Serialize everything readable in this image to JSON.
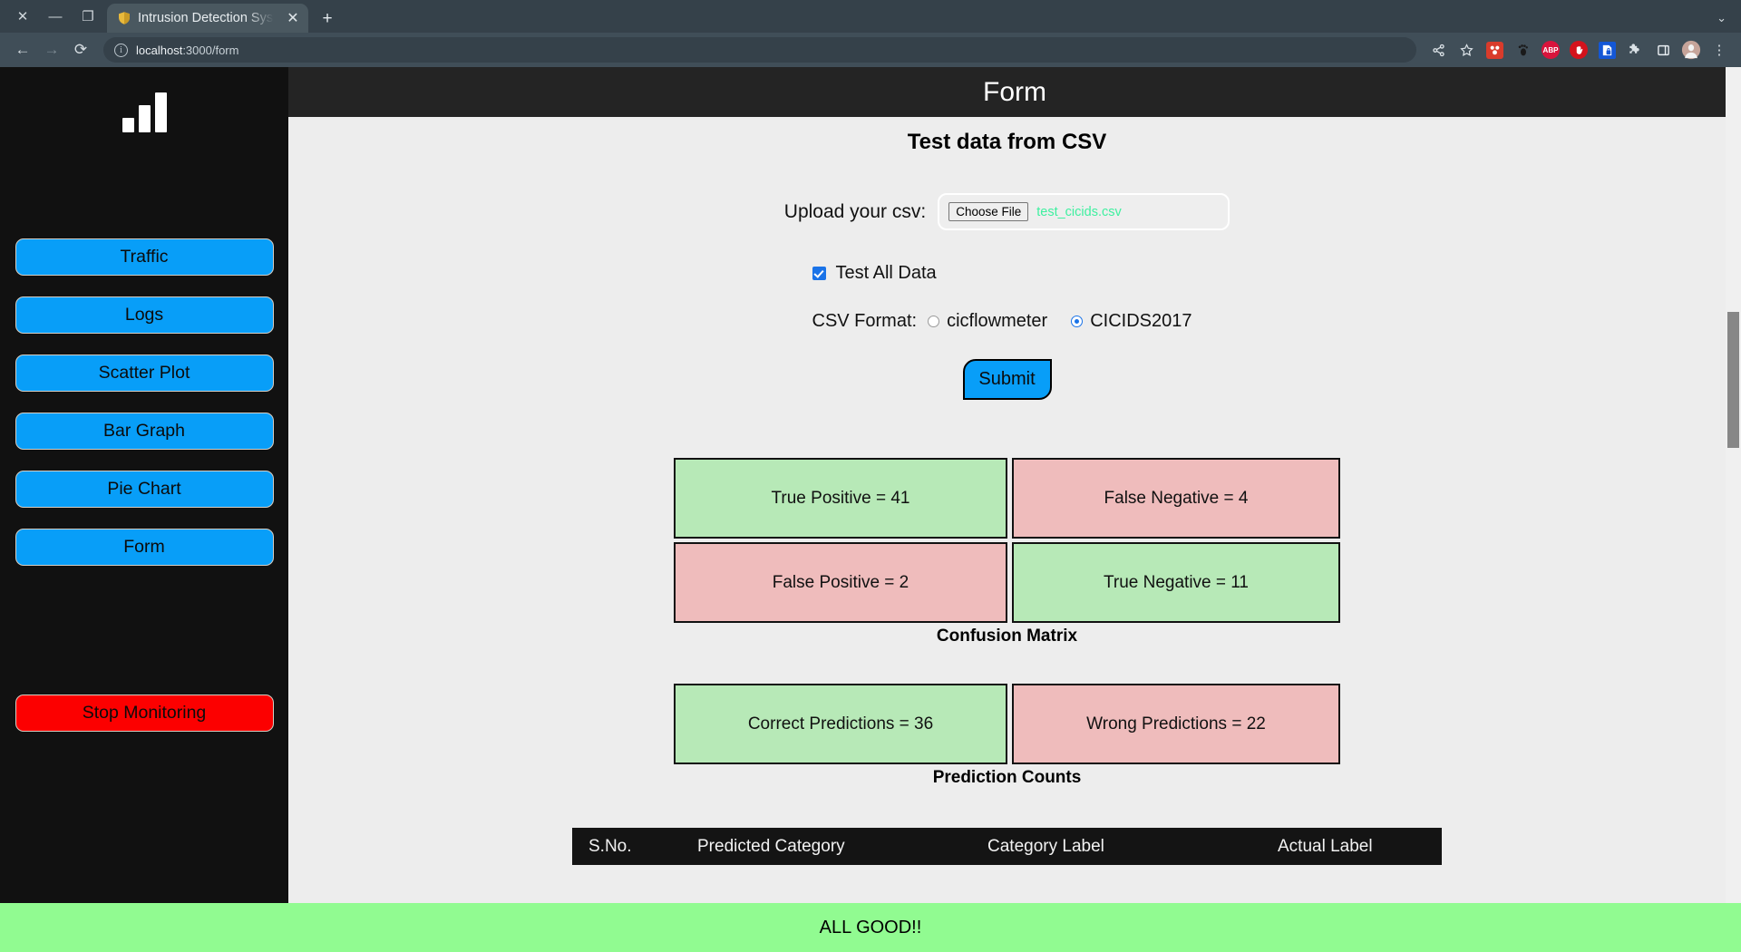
{
  "browser": {
    "window_controls": [
      {
        "name": "close-window-button",
        "glyph": "✕"
      },
      {
        "name": "minimize-window-button",
        "glyph": "—"
      },
      {
        "name": "restore-window-button",
        "glyph": "❐"
      }
    ],
    "tab": {
      "title": "Intrusion Detection Syst",
      "favicon": "shield-icon",
      "close_glyph": "✕"
    },
    "new_tab_glyph": "+",
    "collapse_glyph": "⌄",
    "nav": {
      "back_glyph": "←",
      "forward_glyph": "→",
      "reload_glyph": "⟳"
    },
    "omnibox": {
      "info_glyph": "i",
      "host": "localhost",
      "path": ":3000/form"
    },
    "toolbar_icons": [
      {
        "name": "share-icon",
        "glyph": "≪"
      },
      {
        "name": "bookmark-star-icon",
        "glyph": "☆"
      },
      {
        "name": "extension-red-icon",
        "label": "",
        "color": "#d93b2b"
      },
      {
        "name": "extension-footprint-icon",
        "label": "",
        "color": "#404e58"
      },
      {
        "name": "extension-abp-icon",
        "label": "ABP",
        "color": "#d9143c"
      },
      {
        "name": "extension-stop-hand-icon",
        "label": "",
        "color": "#d4121c"
      },
      {
        "name": "extension-lock-blue-icon",
        "label": "",
        "color": "#1457d6"
      },
      {
        "name": "extensions-puzzle-icon",
        "glyph": "✦"
      },
      {
        "name": "sidepanel-icon",
        "glyph": "▣"
      },
      {
        "name": "profile-avatar-icon",
        "glyph": ""
      },
      {
        "name": "chrome-menu-icon",
        "glyph": "⋮"
      }
    ]
  },
  "sidebar": {
    "logo": {
      "name": "bar-chart-logo",
      "bars": [
        16,
        30,
        44
      ]
    },
    "items": [
      {
        "label": "Traffic"
      },
      {
        "label": "Logs"
      },
      {
        "label": "Scatter Plot"
      },
      {
        "label": "Bar Graph"
      },
      {
        "label": "Pie Chart"
      },
      {
        "label": "Form"
      }
    ],
    "stop_button": {
      "label": "Stop Monitoring"
    }
  },
  "header": {
    "title": "Form"
  },
  "main": {
    "section_title": "Test data from CSV",
    "upload": {
      "label": "Upload your csv:",
      "choose_file_label": "Choose File",
      "file_name": "test_cicids.csv"
    },
    "test_all_data": {
      "label": "Test All Data",
      "checked": true
    },
    "csv_format": {
      "label": "CSV Format:",
      "options": [
        {
          "label": "cicflowmeter",
          "selected": false
        },
        {
          "label": "CICIDS2017",
          "selected": true
        }
      ]
    },
    "submit_label": "Submit",
    "confusion_matrix": {
      "caption": "Confusion Matrix",
      "cells": [
        {
          "label": "True Positive = 41",
          "tone": "good"
        },
        {
          "label": "False Negative = 4",
          "tone": "bad"
        },
        {
          "label": "False Positive = 2",
          "tone": "bad"
        },
        {
          "label": "True Negative = 11",
          "tone": "good"
        }
      ]
    },
    "prediction_counts": {
      "caption": "Prediction Counts",
      "cells": [
        {
          "label": "Correct Predictions = 36",
          "tone": "good"
        },
        {
          "label": "Wrong Predictions = 22",
          "tone": "bad"
        }
      ]
    },
    "results_table": {
      "columns": [
        "S.No.",
        "Predicted Category",
        "Category Label",
        "Actual Label"
      ],
      "rows": []
    }
  },
  "status_bar": {
    "message": "ALL GOOD!!"
  },
  "colors": {
    "accent_blue": "#089ef8",
    "danger_red": "#fc0000",
    "good_green": "#b7e9b7",
    "bad_red": "#efbcbc",
    "status_green": "#91fb91",
    "sidebar_black": "#111111",
    "file_name_green": "#3ef0a0"
  }
}
